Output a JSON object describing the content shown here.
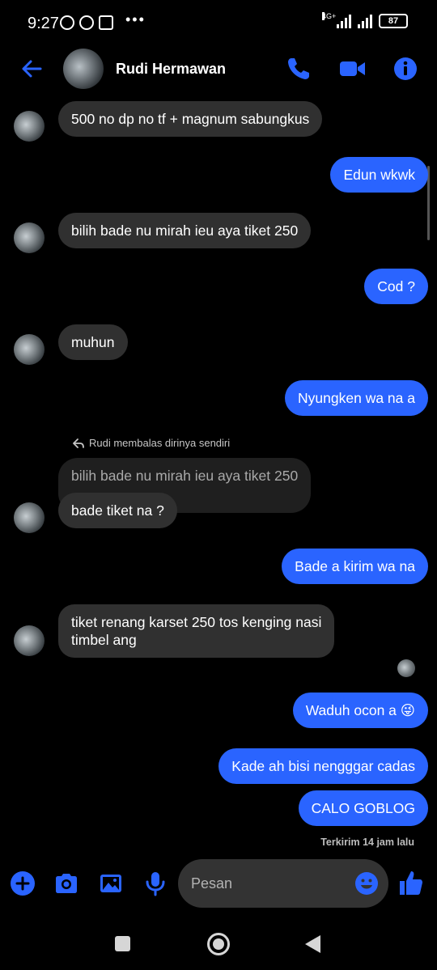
{
  "status_bar": {
    "time": "9:27",
    "network": "4G+",
    "battery": "87"
  },
  "header": {
    "contact_name": "Rudi Hermawan"
  },
  "messages": [
    {
      "from": "contact",
      "text": "500 no dp no tf + magnum sabungkus"
    },
    {
      "from": "me",
      "text": "Edun wkwk"
    },
    {
      "from": "contact",
      "text": "bilih bade nu mirah ieu aya tiket 250"
    },
    {
      "from": "me",
      "text": "Cod ?"
    },
    {
      "from": "contact",
      "text": "muhun"
    },
    {
      "from": "me",
      "text": "Nyungken wa na a"
    },
    {
      "from": "contact",
      "reply_note": "Rudi membalas dirinya sendiri",
      "quoted": "bilih bade nu mirah ieu aya tiket 250",
      "text": "bade tiket na ?"
    },
    {
      "from": "me",
      "text": "Bade a kirim wa na"
    },
    {
      "from": "contact",
      "text_line1": "tiket renang karset 250 tos kenging nasi",
      "text_line2": "timbel ang"
    },
    {
      "from": "me",
      "text": "Waduh ocon a 😜"
    },
    {
      "from": "me",
      "text": "Kade ah bisi nengggar cadas"
    },
    {
      "from": "me",
      "text": "CALO GOBLOG"
    }
  ],
  "sent_status": "Terkirim 14 jam lalu",
  "composer": {
    "placeholder": "Pesan"
  },
  "colors": {
    "accent": "#2a64ff",
    "incoming_bubble": "#303030",
    "background": "#000000"
  }
}
